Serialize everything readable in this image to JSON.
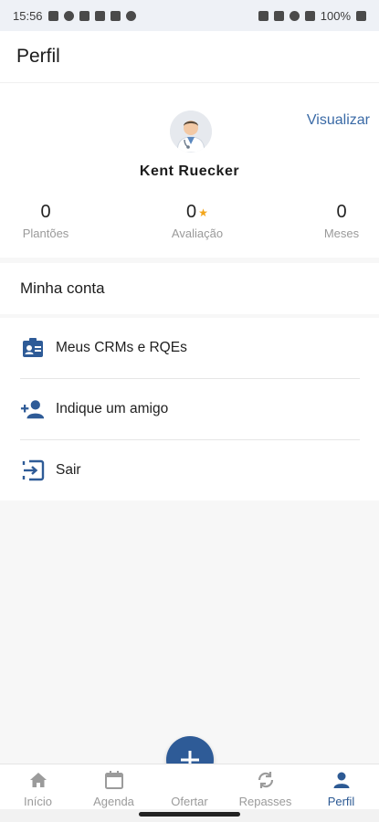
{
  "status_bar": {
    "time": "15:56",
    "battery": "100%"
  },
  "header": {
    "title": "Perfil"
  },
  "profile": {
    "view_label": "Visualizar",
    "name": "Kent Ruecker",
    "stats": [
      {
        "value": "0",
        "label": "Plantões"
      },
      {
        "value": "0",
        "label": "Avaliação"
      },
      {
        "value": "0",
        "label": "Meses"
      }
    ]
  },
  "account": {
    "title": "Minha conta",
    "items": [
      {
        "label": "Meus CRMs e RQEs",
        "icon": "badge-icon"
      },
      {
        "label": "Indique um amigo",
        "icon": "add-person-icon"
      },
      {
        "label": "Sair",
        "icon": "logout-icon"
      }
    ]
  },
  "nav": {
    "items": [
      {
        "label": "Início",
        "icon": "home-icon"
      },
      {
        "label": "Agenda",
        "icon": "calendar-icon"
      },
      {
        "label": "Ofertar",
        "icon": "plus-icon"
      },
      {
        "label": "Repasses",
        "icon": "sync-icon"
      },
      {
        "label": "Perfil",
        "icon": "person-icon"
      }
    ]
  },
  "colors": {
    "accent": "#2e5b97",
    "star": "#f2a51a",
    "link": "#3a6aa6"
  }
}
